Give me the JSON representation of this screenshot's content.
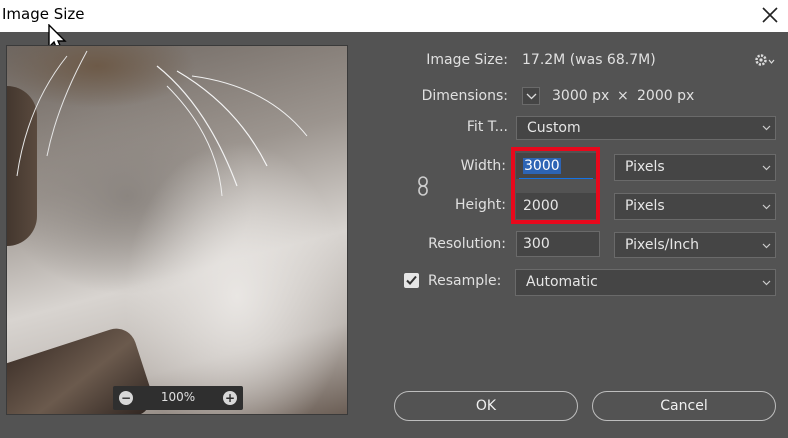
{
  "window": {
    "title": "Image Size"
  },
  "preview": {
    "zoom": "100%",
    "zoom_out_symbol": "−",
    "zoom_in_symbol": "+"
  },
  "info": {
    "image_size_label": "Image Size:",
    "image_size_value": "17.2M (was 68.7M)",
    "dimensions_label": "Dimensions:",
    "dim_width": "3000 px",
    "dim_times": "×",
    "dim_height": "2000 px"
  },
  "fit": {
    "label": "Fit T...",
    "value": "Custom"
  },
  "width": {
    "label": "Width:",
    "value": "3000",
    "unit": "Pixels"
  },
  "height": {
    "label": "Height:",
    "value": "2000",
    "unit": "Pixels"
  },
  "resolution": {
    "label": "Resolution:",
    "value": "300",
    "unit": "Pixels/Inch"
  },
  "resample": {
    "label": "Resample:",
    "checked": true,
    "value": "Automatic"
  },
  "buttons": {
    "ok": "OK",
    "cancel": "Cancel"
  },
  "colors": {
    "highlight": "#e8081c",
    "selection": "#2d64b4",
    "background": "#535353"
  },
  "icons": [
    "close-icon",
    "gear-icon",
    "chevron-down-icon",
    "link-icon",
    "checkmark-icon",
    "zoom-out-icon",
    "zoom-in-icon",
    "mouse-cursor-icon"
  ]
}
